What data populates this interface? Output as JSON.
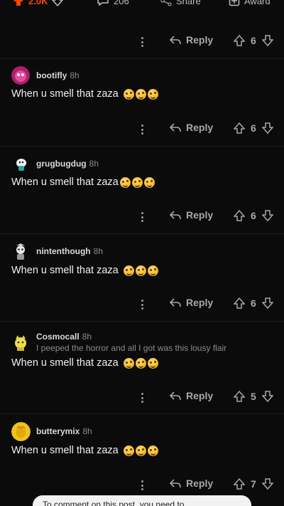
{
  "post_bar": {
    "upvotes": "2.0K",
    "comments": "206",
    "share_label": "Share",
    "award_label": "Award"
  },
  "reply_label": "Reply",
  "comments": [
    {
      "vote_count": "6"
    },
    {
      "username": "bootifly",
      "time": "8h",
      "text": "When u smell that zaza",
      "vote_count": "6",
      "avatar": "pink-avatar"
    },
    {
      "username": "grugbugdug",
      "time": "8h",
      "text": "When u smell that zaza",
      "vote_count": "6",
      "avatar": "white-blob-avatar"
    },
    {
      "username": "nintenthough",
      "time": "8h",
      "text": "When u smell that zaza",
      "vote_count": "6",
      "avatar": "robot-avatar"
    },
    {
      "username": "Cosmocall",
      "time": "8h",
      "flair": "I peeped the horror and all I got was this lousy flair",
      "text": "When u smell that zaza",
      "vote_count": "5",
      "avatar": "yellow-cat-avatar"
    },
    {
      "username": "butterymix",
      "time": "8h",
      "text": "When u smell that zaza",
      "vote_count": "7",
      "avatar": "yellow-round-avatar"
    }
  ],
  "emoji_name": "woozy-face-emoji",
  "colors": {
    "upvote": "#ff4500",
    "background": "#0b0b0b",
    "muted": "#a8a8a8"
  },
  "bottom_toast": "To comment on this post, you need to ..."
}
